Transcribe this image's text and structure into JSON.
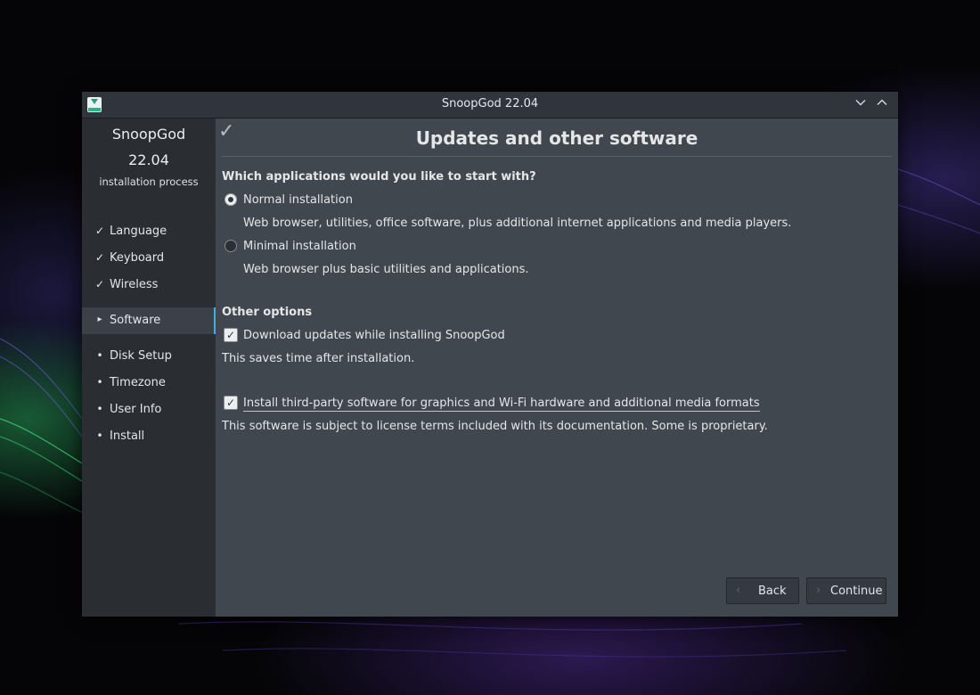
{
  "window": {
    "title": "SnoopGod 22.04"
  },
  "sidebar": {
    "product": "SnoopGod",
    "version": "22.04",
    "subtitle": "installation process",
    "steps": [
      {
        "mark": "✓",
        "label": "Language"
      },
      {
        "mark": "✓",
        "label": "Keyboard"
      },
      {
        "mark": "✓",
        "label": "Wireless"
      },
      {
        "mark": "▸",
        "label": "Software"
      },
      {
        "mark": "•",
        "label": "Disk Setup"
      },
      {
        "mark": "•",
        "label": "Timezone"
      },
      {
        "mark": "•",
        "label": "User Info"
      },
      {
        "mark": "•",
        "label": "Install"
      }
    ],
    "active_step": "Software"
  },
  "content": {
    "title": "Updates and other software",
    "question": "Which applications would you like to start with?",
    "options": [
      {
        "label": "Normal installation",
        "description": "Web browser, utilities, office software, plus additional internet applications and media players.",
        "selected": true
      },
      {
        "label": "Minimal installation",
        "description": "Web browser plus basic utilities and applications.",
        "selected": false
      }
    ],
    "other_heading": "Other options",
    "checks": [
      {
        "label": "Download updates while installing SnoopGod",
        "note": "This saves time after installation.",
        "checked": true
      },
      {
        "label": "Install third-party software for graphics and Wi-Fi hardware and additional media formats",
        "note": "This software is subject to license terms included with its documentation. Some is proprietary.",
        "checked": true
      }
    ]
  },
  "buttons": {
    "back": "Back",
    "continue": "Continue"
  },
  "colors": {
    "accent": "#3daee9",
    "content_bg": "#41474f",
    "sidebar_bg": "#2a2e32",
    "titlebar_bg": "#30353b"
  }
}
